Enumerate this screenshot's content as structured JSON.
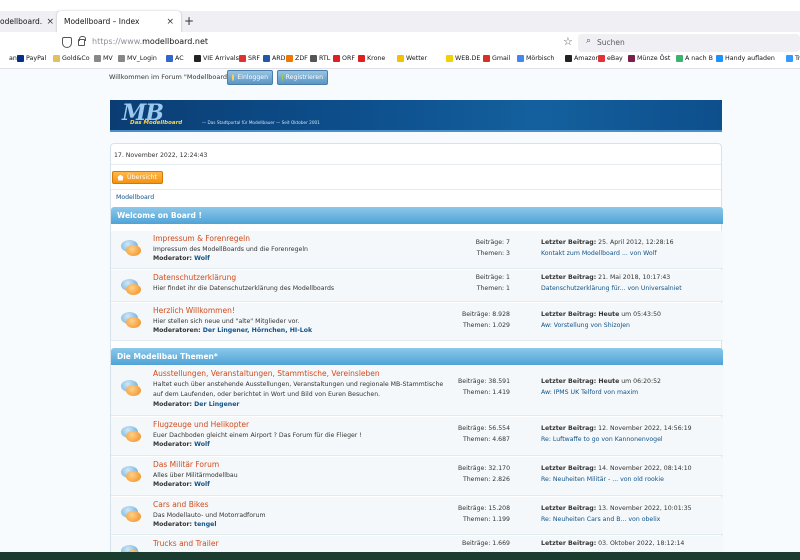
{
  "browser": {
    "tabs": [
      {
        "label": "odellboard.net",
        "close": "×"
      },
      {
        "label": "Modellboard – Index",
        "close": "×"
      }
    ],
    "new_tab": "+",
    "url_prefix": "https://www.",
    "url_domain": "modellboard.net",
    "search_placeholder": "Suchen",
    "bookmarks": [
      {
        "label": "ank",
        "color": "#ffffff"
      },
      {
        "label": "PayPal",
        "color": "#003087"
      },
      {
        "label": "Gold&Co",
        "color": "#e0c060"
      },
      {
        "label": "MV",
        "color": "#888888"
      },
      {
        "label": "MV_Login",
        "color": "#888888"
      },
      {
        "label": "AC",
        "color": "#3366cc"
      },
      {
        "label": "VIE Arrivals",
        "color": "#222222"
      },
      {
        "label": "SRF",
        "color": "#e03030"
      },
      {
        "label": "ARD",
        "color": "#1e5aa8"
      },
      {
        "label": "ZDF",
        "color": "#f07800"
      },
      {
        "label": "RTL",
        "color": "#555555"
      },
      {
        "label": "ORF",
        "color": "#e02020"
      },
      {
        "label": "Krone",
        "color": "#e02020"
      },
      {
        "label": "Wetter",
        "color": "#f5c000"
      },
      {
        "label": "WEB.DE",
        "color": "#f5d000"
      },
      {
        "label": "Gmail",
        "color": "#d93025"
      },
      {
        "label": "Mörbisch",
        "color": "#4285f4"
      },
      {
        "label": "Amazon",
        "color": "#222222"
      },
      {
        "label": "eBay",
        "color": "#e53238"
      },
      {
        "label": "Münze Öst",
        "color": "#7a1f4a"
      },
      {
        "label": "A nach B",
        "color": "#3cb371"
      },
      {
        "label": "Handy aufladen",
        "color": "#1e90ff"
      },
      {
        "label": "Trans",
        "color": "#3399ff"
      }
    ]
  },
  "header": {
    "welcome": "Willkommen im Forum \"Modellboard\".",
    "login": "Einloggen",
    "register": "Registrieren"
  },
  "banner": {
    "logo": "MB",
    "logo_sub": "Das Modellboard",
    "slogan": "— Das Stadtportal für Modellbauer — Seit Oktober 2001"
  },
  "page": {
    "date": "17. November 2022, 12:24:43",
    "uebersicht": "Übersicht",
    "breadcrumb": "Modellboard"
  },
  "categories": [
    {
      "title": "Welcome on Board !",
      "forums": [
        {
          "title": "Impressum & Forenregeln",
          "desc": "Impressum des ModellBoards und die Forenregeln",
          "mod_label": "Moderator:",
          "mod": "Wolf",
          "posts": "Beiträge: 7",
          "topics": "Themen: 3",
          "last_label": "Letzter Beitrag:",
          "last_date": "25. April 2012, 12:28:16",
          "last_link": "Kontakt zum Modellboard ... von Wolf"
        },
        {
          "title": "Datenschutzerklärung",
          "desc": "Hier findet ihr die Datenschutzerklärung des Modellboards",
          "mod_label": "",
          "mod": "",
          "posts": "Beiträge: 1",
          "topics": "Themen: 1",
          "last_label": "Letzter Beitrag:",
          "last_date": "21. Mai 2018, 10:17:43",
          "last_link": "Datenschutzerklärung für... von Universalniet"
        },
        {
          "title": "Herzlich Willkommen!",
          "desc": "Hier stellen sich neue und \"alte\" Mitglieder vor.",
          "mod_label": "Moderatoren:",
          "mod": "Der Lingener, Hörnchen, HI-Lok",
          "posts": "Beiträge: 8.928",
          "topics": "Themen: 1.029",
          "last_label": "Letzter Beitrag: Heute",
          "last_date": "um 05:43:50",
          "last_link": "Aw: Vorstellung von ShizoJen"
        }
      ]
    },
    {
      "title": "Die Modellbau Themen*",
      "forums": [
        {
          "title": "Ausstellungen, Veranstaltungen, Stammtische, Vereinsleben",
          "desc": "Haltet euch über anstehende Ausstellungen, Veranstaltungen und regionale MB-Stammtische auf dem Laufenden, oder berichtet in Wort und Bild von Euren Besuchen.",
          "mod_label": "Moderator:",
          "mod": "Der Lingener",
          "posts": "Beiträge: 38.591",
          "topics": "Themen: 1.419",
          "last_label": "Letzter Beitrag: Heute",
          "last_date": "um 06:20:52",
          "last_link": "Aw: IPMS UK Telford von maxim"
        },
        {
          "title": "Flugzeuge und Helikopter",
          "desc": "Euer Dachboden gleicht einem Airport ? Das Forum für die Flieger !",
          "mod_label": "Moderator:",
          "mod": "Wolf",
          "posts": "Beiträge: 56.554",
          "topics": "Themen: 4.687",
          "last_label": "Letzter Beitrag:",
          "last_date": "12. November 2022, 14:56:19",
          "last_link": "Re: Luftwaffe to go von Kannonenvogel"
        },
        {
          "title": "Das Militär Forum",
          "desc": "Alles über Militärmodellbau",
          "mod_label": "Moderator:",
          "mod": "Wolf",
          "posts": "Beiträge: 32.170",
          "topics": "Themen: 2.826",
          "last_label": "Letzter Beitrag:",
          "last_date": "14. November 2022, 08:14:10",
          "last_link": "Re: Neuheiten Militär - ... von old rookie"
        },
        {
          "title": "Cars and Bikes",
          "desc": "Das Modellauto- und Motorradforum",
          "mod_label": "Moderator:",
          "mod": "tengel",
          "posts": "Beiträge: 15.208",
          "topics": "Themen: 1.199",
          "last_label": "Letzter Beitrag:",
          "last_date": "13. November 2022, 10:01:35",
          "last_link": "Re: Neuheiten Cars and B... von obelix"
        },
        {
          "title": "Trucks and Trailer",
          "desc": "",
          "mod_label": "",
          "mod": "",
          "posts": "Beiträge: 1.669",
          "topics": "",
          "last_label": "Letzter Beitrag:",
          "last_date": "03. Oktober 2022, 18:12:14",
          "last_link": ""
        }
      ]
    }
  ]
}
